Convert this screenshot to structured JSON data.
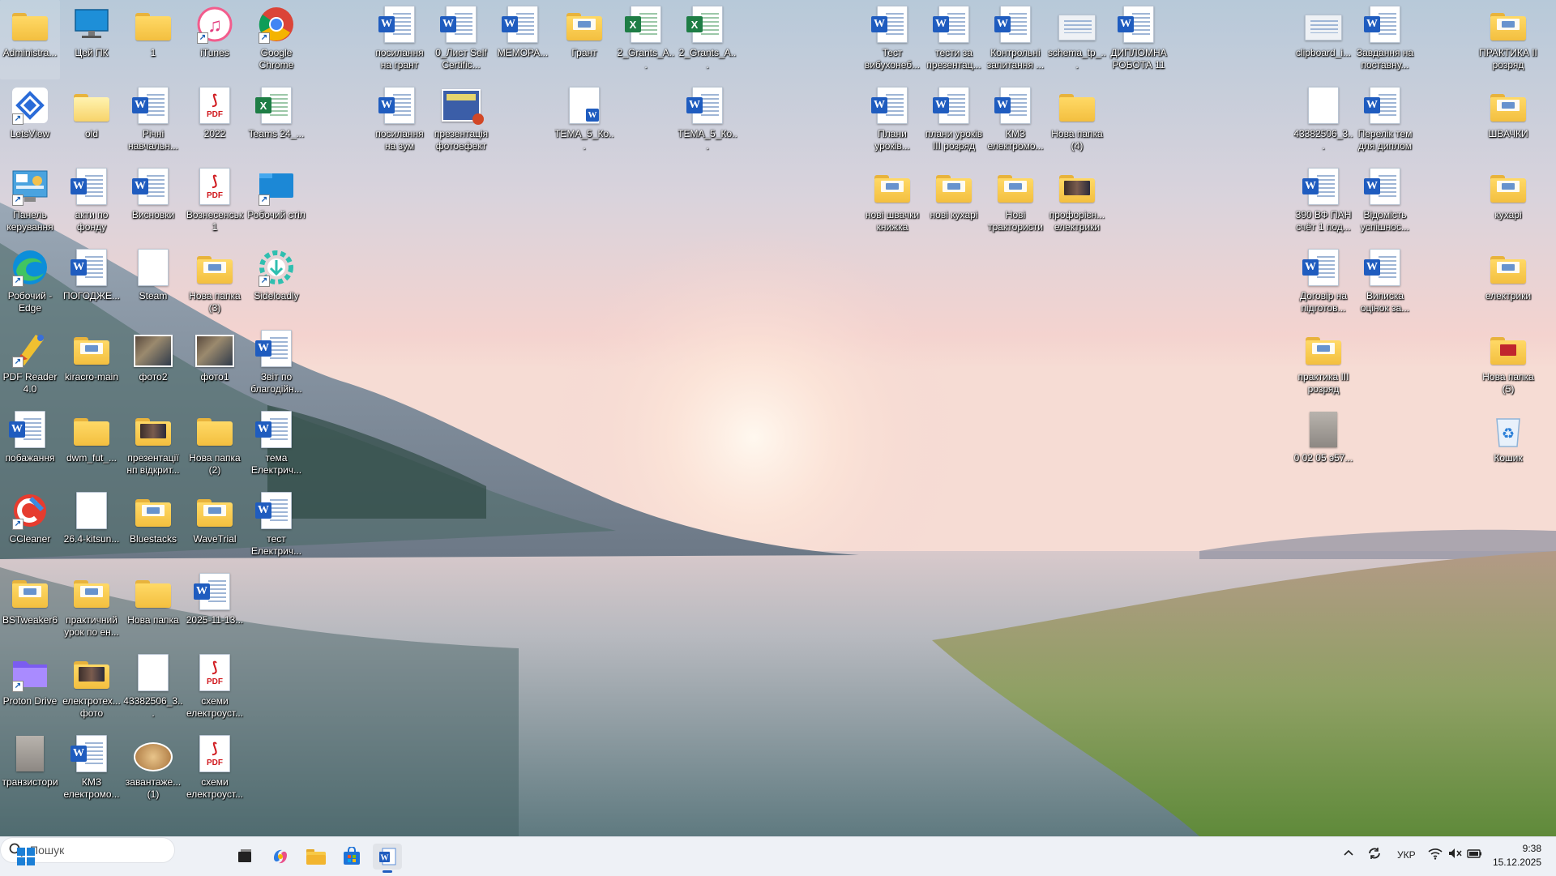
{
  "desktop": {
    "icons": [
      {
        "label": "Administra...",
        "type": "folder"
      },
      {
        "label": "Цей ПК",
        "type": "pc"
      },
      {
        "label": "1",
        "type": "folder"
      },
      {
        "label": "iTunes",
        "type": "itunes"
      },
      {
        "label": "Google Chrome",
        "type": "chrome"
      },
      {
        "label": "посилання на грант",
        "type": "word"
      },
      {
        "label": "0_Лист Self Certific...",
        "type": "word"
      },
      {
        "label": "МЕМОРА...",
        "type": "word"
      },
      {
        "label": "Грант",
        "type": "folder-doc"
      },
      {
        "label": "2_Grants_A...",
        "type": "excel"
      },
      {
        "label": "2_Grants_A...",
        "type": "excel"
      },
      {
        "label": "Тест вибухонеб...",
        "type": "word"
      },
      {
        "label": "тести за презентац...",
        "type": "word"
      },
      {
        "label": "Контрольні запитання ...",
        "type": "word"
      },
      {
        "label": "schema_tp_...",
        "type": "thumb"
      },
      {
        "label": "ДИПЛОМНА РОБОТА 11",
        "type": "word"
      },
      {
        "label": "clipboard_i...",
        "type": "thumb"
      },
      {
        "label": "Завдання на поставну...",
        "type": "word"
      },
      {
        "label": "ПРАКТИКА ІІ розряд",
        "type": "folder-doc"
      },
      {
        "label": "LetsView",
        "type": "letsview"
      },
      {
        "label": "old",
        "type": "folder-open"
      },
      {
        "label": "Річні навчальн...",
        "type": "word"
      },
      {
        "label": "2022",
        "type": "pdf"
      },
      {
        "label": "Teams 24_...",
        "type": "excel"
      },
      {
        "label": "посилання на зум",
        "type": "word"
      },
      {
        "label": "презентація фотоефект",
        "type": "ppt"
      },
      {
        "label": "ТЕМА_5_Ко...",
        "type": "word-blank"
      },
      {
        "label": "ТЕМА_5_Ко...",
        "type": "word"
      },
      {
        "label": "Плани уроків...",
        "type": "word"
      },
      {
        "label": "плани уроків ІІІ розряд",
        "type": "word"
      },
      {
        "label": "КМЗ електромо...",
        "type": "word"
      },
      {
        "label": "Нова папка (4)",
        "type": "folder"
      },
      {
        "label": "43382506_3...",
        "type": "blank"
      },
      {
        "label": "Перелік тем для диплом",
        "type": "word"
      },
      {
        "label": "ШВАЧКИ",
        "type": "folder-doc"
      },
      {
        "label": "Панель керування",
        "type": "control"
      },
      {
        "label": "акти по фонду",
        "type": "word"
      },
      {
        "label": "Висновки",
        "type": "word"
      },
      {
        "label": "Вознесенськ 1",
        "type": "pdf"
      },
      {
        "label": "Робочий стіл",
        "type": "desktop"
      },
      {
        "label": "нові швачки книжка",
        "type": "folder-doc"
      },
      {
        "label": "нові кухарі",
        "type": "folder-doc"
      },
      {
        "label": "Нові трактористи",
        "type": "folder-doc"
      },
      {
        "label": "профорієн... електрики",
        "type": "folder-photo"
      },
      {
        "label": "390 ВФ ПАН счёт 1 под...",
        "type": "word"
      },
      {
        "label": "Відомість успішнос...",
        "type": "word"
      },
      {
        "label": "кухарі",
        "type": "folder-doc"
      },
      {
        "label": "Робочий - Edge",
        "type": "edge"
      },
      {
        "label": "ПОГОДЖЕ...",
        "type": "word"
      },
      {
        "label": "Steam",
        "type": "blank"
      },
      {
        "label": "Нова папка (3)",
        "type": "folder-doc"
      },
      {
        "label": "Sideloadly",
        "type": "sideloadly"
      },
      {
        "label": "Договір на підготов...",
        "type": "word"
      },
      {
        "label": "Виписка оцінок за...",
        "type": "word"
      },
      {
        "label": "електрики",
        "type": "folder-doc"
      },
      {
        "label": "PDF Reader 4.0",
        "type": "pdfreader"
      },
      {
        "label": "kiracro-main",
        "type": "folder-doc"
      },
      {
        "label": "фото2",
        "type": "photo"
      },
      {
        "label": "фото1",
        "type": "photo"
      },
      {
        "label": "Звіт по благодійн...",
        "type": "word"
      },
      {
        "label": "практика ІІІ розряд",
        "type": "folder-doc"
      },
      {
        "label": "Нова папка (5)",
        "type": "folder-red"
      },
      {
        "label": "побажання",
        "type": "word"
      },
      {
        "label": "dwm_fut_...",
        "type": "folder"
      },
      {
        "label": "презентації нп відкрит...",
        "type": "folder-photo"
      },
      {
        "label": "Нова папка (2)",
        "type": "folder"
      },
      {
        "label": "тема Електрич...",
        "type": "word"
      },
      {
        "label": "0 02 05 э57...",
        "type": "thumb-gray"
      },
      {
        "label": "Кошик",
        "type": "recycle"
      },
      {
        "label": "CCleaner",
        "type": "ccleaner"
      },
      {
        "label": "26.4-kitsun...",
        "type": "blank"
      },
      {
        "label": "Bluestacks",
        "type": "folder-doc"
      },
      {
        "label": "WaveTrial",
        "type": "folder-doc"
      },
      {
        "label": "тест Електрич...",
        "type": "word"
      },
      {
        "label": "BSTweaker6",
        "type": "folder-doc"
      },
      {
        "label": "практичний урок по ен...",
        "type": "folder-doc"
      },
      {
        "label": "Нова папка",
        "type": "folder"
      },
      {
        "label": "2025-11-13...",
        "type": "word"
      },
      {
        "label": "Proton Drive",
        "type": "proton"
      },
      {
        "label": "електротех... фото",
        "type": "folder-photo"
      },
      {
        "label": "43382506_3...",
        "type": "blank"
      },
      {
        "label": "схеми електроуст...",
        "type": "pdf"
      },
      {
        "label": "транзистори",
        "type": "thumb-gray"
      },
      {
        "label": "КМЗ електромо...",
        "type": "word"
      },
      {
        "label": "завантаже... (1)",
        "type": "food"
      },
      {
        "label": "схеми електроуст...",
        "type": "pdf"
      }
    ]
  },
  "taskbar": {
    "search_placeholder": "Пошук",
    "pinned": [
      {
        "name": "task-view",
        "icon": "task-view-icon"
      },
      {
        "name": "copilot",
        "icon": "copilot-icon"
      },
      {
        "name": "file-explorer",
        "icon": "folder-icon"
      },
      {
        "name": "microsoft-store",
        "icon": "store-icon"
      },
      {
        "name": "word",
        "icon": "word-icon"
      }
    ],
    "tray": {
      "language": "УКР",
      "time": "9:38",
      "date": "15.12.2025"
    }
  },
  "colors": {
    "accent": "#1f5cbf",
    "folder": "#f3bf3f",
    "taskbar": "#eef1f6"
  }
}
